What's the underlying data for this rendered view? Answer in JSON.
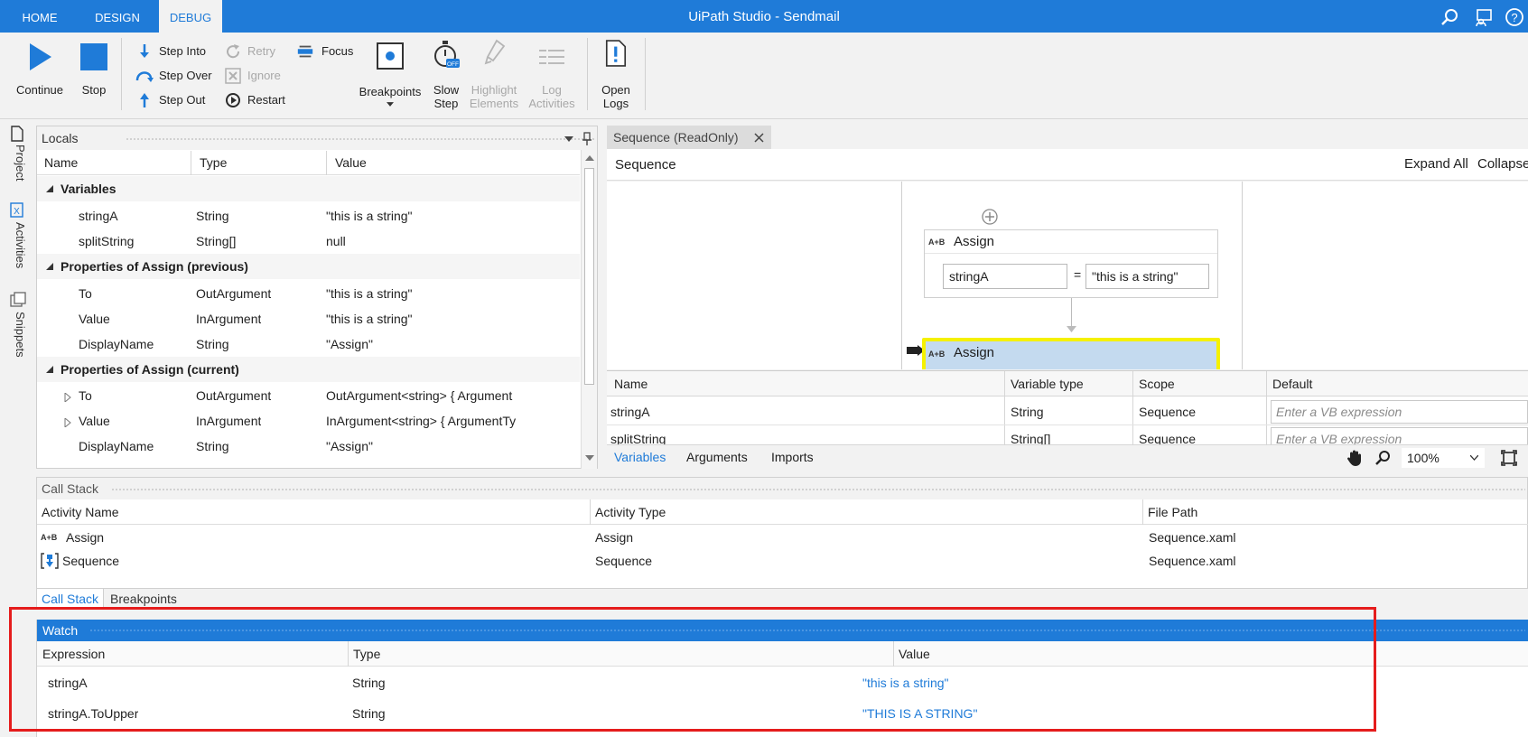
{
  "titlebar": {
    "tabs": [
      "HOME",
      "DESIGN",
      "DEBUG"
    ],
    "active_tab": "DEBUG",
    "app_title": "UiPath Studio - Sendmail",
    "icons": [
      "search-icon",
      "feedback-icon",
      "help-icon"
    ]
  },
  "ribbon": {
    "continue": "Continue",
    "stop": "Stop",
    "step_into": "Step Into",
    "step_over": "Step Over",
    "step_out": "Step Out",
    "retry": "Retry",
    "ignore": "Ignore",
    "restart": "Restart",
    "focus": "Focus",
    "breakpoints": "Breakpoints",
    "slow_step_1": "Slow",
    "slow_step_2": "Step",
    "slow_step_badge": "OFF",
    "highlight_1": "Highlight",
    "highlight_2": "Elements",
    "log_1": "Log",
    "log_2": "Activities",
    "open_logs_1": "Open",
    "open_logs_2": "Logs",
    "accent": "#1f7bd8"
  },
  "side_tabs": [
    "Project",
    "Activities",
    "Snippets"
  ],
  "locals": {
    "title": "Locals",
    "columns": [
      "Name",
      "Type",
      "Value"
    ],
    "groups": [
      {
        "label": "Variables",
        "rows": [
          {
            "name": "stringA",
            "type": "String",
            "value": "\"this is a string\""
          },
          {
            "name": "splitString",
            "type": "String[]",
            "value": "null"
          }
        ]
      },
      {
        "label": "Properties of Assign (previous)",
        "rows": [
          {
            "name": "To",
            "type": "OutArgument",
            "value": "\"this is a string\""
          },
          {
            "name": "Value",
            "type": "InArgument",
            "value": "\"this is a string\""
          },
          {
            "name": "DisplayName",
            "type": "String",
            "value": "\"Assign\""
          }
        ]
      },
      {
        "label": "Properties of Assign (current)",
        "rows": [
          {
            "name": "To",
            "type": "OutArgument",
            "value": "OutArgument<string> { Argument"
          },
          {
            "name": "Value",
            "type": "InArgument",
            "value": "InArgument<string> { ArgumentTy"
          },
          {
            "name": "DisplayName",
            "type": "String",
            "value": "\"Assign\""
          }
        ]
      }
    ]
  },
  "designer": {
    "tab_label": "Sequence (ReadOnly)",
    "breadcrumb": "Sequence",
    "expand_all": "Expand All",
    "collapse_all": "Collapse",
    "assign1": {
      "title": "Assign",
      "to": "stringA",
      "eq": "=",
      "value": "\"this is a string\""
    },
    "assign2": {
      "title": "Assign"
    },
    "icon_label": "A+B",
    "var_columns": [
      "Name",
      "Variable type",
      "Scope",
      "Default"
    ],
    "variables": [
      {
        "name": "stringA",
        "type": "String",
        "scope": "Sequence",
        "default": "Enter a VB expression"
      },
      {
        "name": "splitString",
        "type": "String[]",
        "scope": "Sequence",
        "default": "Enter a VB expression"
      }
    ],
    "bottom_tabs": [
      "Variables",
      "Arguments",
      "Imports"
    ],
    "zoom": "100%"
  },
  "callstack": {
    "title": "Call Stack",
    "columns": [
      "Activity Name",
      "Activity Type",
      "File Path"
    ],
    "rows": [
      {
        "name": "Assign",
        "type": "Assign",
        "path": "Sequence.xaml",
        "icon": "assign-icon"
      },
      {
        "name": "Sequence",
        "type": "Sequence",
        "path": "Sequence.xaml",
        "icon": "sequence-icon"
      }
    ],
    "tabs": [
      "Call Stack",
      "Breakpoints"
    ]
  },
  "watch": {
    "title": "Watch",
    "columns": [
      "Expression",
      "Type",
      "Value"
    ],
    "rows": [
      {
        "expr": "stringA",
        "type": "String",
        "value": "\"this is a string\""
      },
      {
        "expr": "stringA.ToUpper",
        "type": "String",
        "value": "\"THIS IS A STRING\""
      }
    ],
    "highlight_color": "#e51c1c"
  }
}
